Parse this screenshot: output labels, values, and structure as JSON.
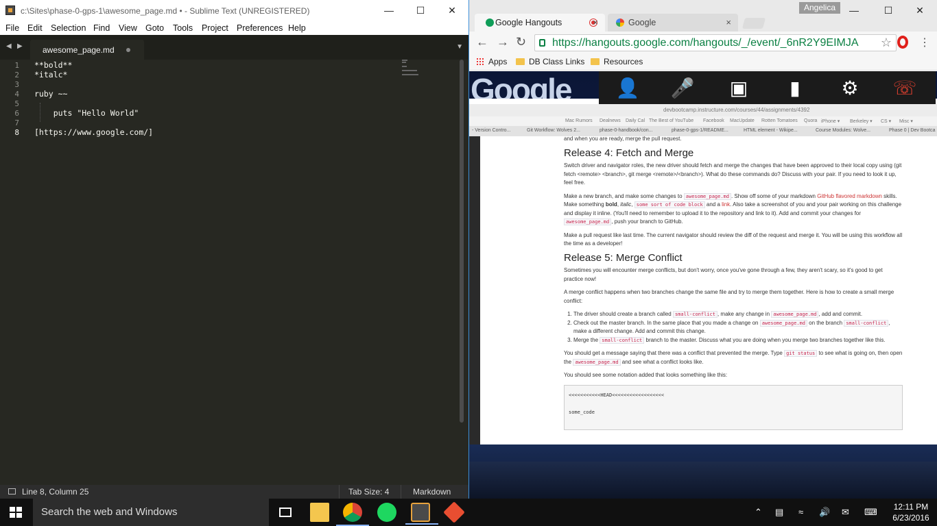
{
  "sublime": {
    "title": "c:\\Sites\\phase-0-gps-1\\awesome_page.md • - Sublime Text (UNREGISTERED)",
    "menu": [
      "File",
      "Edit",
      "Selection",
      "Find",
      "View",
      "Goto",
      "Tools",
      "Project",
      "Preferences",
      "Help"
    ],
    "tab": "awesome_page.md",
    "lines": [
      "**bold**",
      "*italc*",
      "",
      "ruby ~~",
      "",
      "    puts \"Hello World\"",
      "",
      "[https://www.google.com/]"
    ],
    "line_numbers": [
      "1",
      "2",
      "3",
      "4",
      "5",
      "6",
      "7",
      "8"
    ],
    "status": {
      "position": "Line 8, Column 25",
      "tab_size": "Tab Size: 4",
      "syntax": "Markdown"
    }
  },
  "chrome": {
    "user": "Angelica",
    "tabs": [
      {
        "label": "Google Hangouts",
        "close": "×"
      },
      {
        "label": "Google",
        "close": "×"
      }
    ],
    "url": "https://hangouts.google.com/hangouts/_/event/_6nR2Y9EIMJA",
    "bookmarks": [
      "Apps",
      "DB Class Links",
      "Resources"
    ],
    "logo": "Google"
  },
  "shared": {
    "mini_url": "devbootcamp.instructure.com/courses/44/assignments/4392",
    "mini_bookmarks": [
      "Mac Rumors",
      "Dealnews",
      "Daily Cal",
      "The Best of YouTube",
      "Facebook",
      "MacUpdate",
      "Rotten Tomatoes",
      "Quora",
      "iPhone ▾",
      "Berkeley ▾",
      "CS ▾",
      "Misc ▾"
    ],
    "mini_tabs": [
      "- Version Contro...",
      "Git Workflow: Wolves 2...",
      "phase-0-handbook/con...",
      "phase-0-gps-1/README...",
      "HTML element - Wikipe...",
      "Course Modules: Wolve...",
      "Phase 0 | Dev Bootca"
    ],
    "intro": "and when you are ready, merge the pull request.",
    "h1": "Release 4: Fetch and Merge",
    "p1": "Switch driver and navigator roles, the new driver should fetch and merge the changes that have been approved to their local copy using (git fetch <remote> <branch>, git merge <remote>/<branch>). What do these commands do? Discuss with your pair. If you need to look it up, feel free.",
    "p2a": "Make a new branch, and make some changes to ",
    "c_awesome": "awesome_page.md",
    "p2b": ". Show off some of your markdown ",
    "link_gfm": "GitHub flavored markdown",
    "p2c": " skills. Make something ",
    "bold": "bold",
    "italic": "italic",
    "c_code": "some sort of code block",
    "p2d": " and a ",
    "link": "link",
    "p2e": ". Also take a screenshot of you and your pair working on this challenge and display it inline. (You'll need to remember to upload it to the repository and link to it). Add and commit your changes for ",
    "p2f": ", push your branch to GitHub.",
    "p3": "Make a pull request like last time. The current navigator should review the diff of the request and merge it. You will be using this workflow all the time as a developer!",
    "h2": "Release 5: Merge Conflict",
    "p4": "Sometimes you will encounter merge conflicts, but don't worry, once you've gone through a few, they aren't scary, so it's good to get practice now!",
    "p5": "A merge conflict happens when two branches change the same file and try to merge them together. Here is how to create a small merge conflict:",
    "li1a": "The driver should create a branch called ",
    "c_small": "small-conflict",
    "li1b": ", make any change in ",
    "li1c": ", add and commit.",
    "li2a": "Check out the master branch. In the same place that you made a change on ",
    "li2b": " on the branch ",
    "li2c": ", make a different change. Add and commit this change.",
    "li3a": "Merge the ",
    "li3b": " branch to the master. Discuss what you are doing when you merge two branches together like this.",
    "p6a": "You should get a message saying that there was a conflict that prevented the merge. Type ",
    "c_git": "git status",
    "p6b": " to see what is going on, then open the ",
    "p6c": " and see what a conflict looks like.",
    "p7": "You should see some notation added that looks something like this:",
    "pre1": "<<<<<<<<<<<HEAD<<<<<<<<<<<<<<<<<<",
    "pre2": "some_code"
  },
  "taskbar": {
    "search": "Search the web and Windows",
    "time": "12:11 PM",
    "date": "6/23/2016"
  },
  "colors": {
    "sublime_bg": "#272822",
    "chrome_url": "#0b8043",
    "taskbar": "#101010"
  }
}
